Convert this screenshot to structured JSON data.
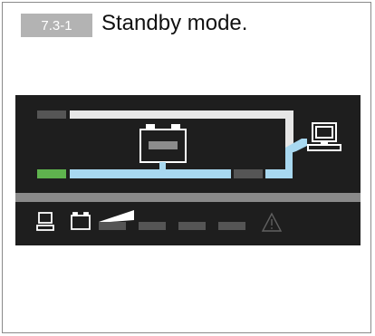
{
  "section": {
    "number": "7.3-1",
    "title": "Standby mode."
  },
  "display": {
    "mode": "standby",
    "colors": {
      "panel_background": "#1e1e1e",
      "bypass_line": "#e6e6e6",
      "power_flow_line": "#a8d8f0",
      "input_indicator_on": "#5fb34e",
      "indicator_off": "#555555",
      "separator_bar": "#8a8a8a",
      "icon_stroke": "#ffffff",
      "warning_icon": "#606060"
    },
    "icons": {
      "battery": "battery-icon",
      "load": "computer-icon",
      "status_load": "computer-icon",
      "status_battery": "battery-icon",
      "load_level": "load-level-ramp-icon",
      "warning": "warning-triangle-icon"
    },
    "level_bar_count": 4
  }
}
